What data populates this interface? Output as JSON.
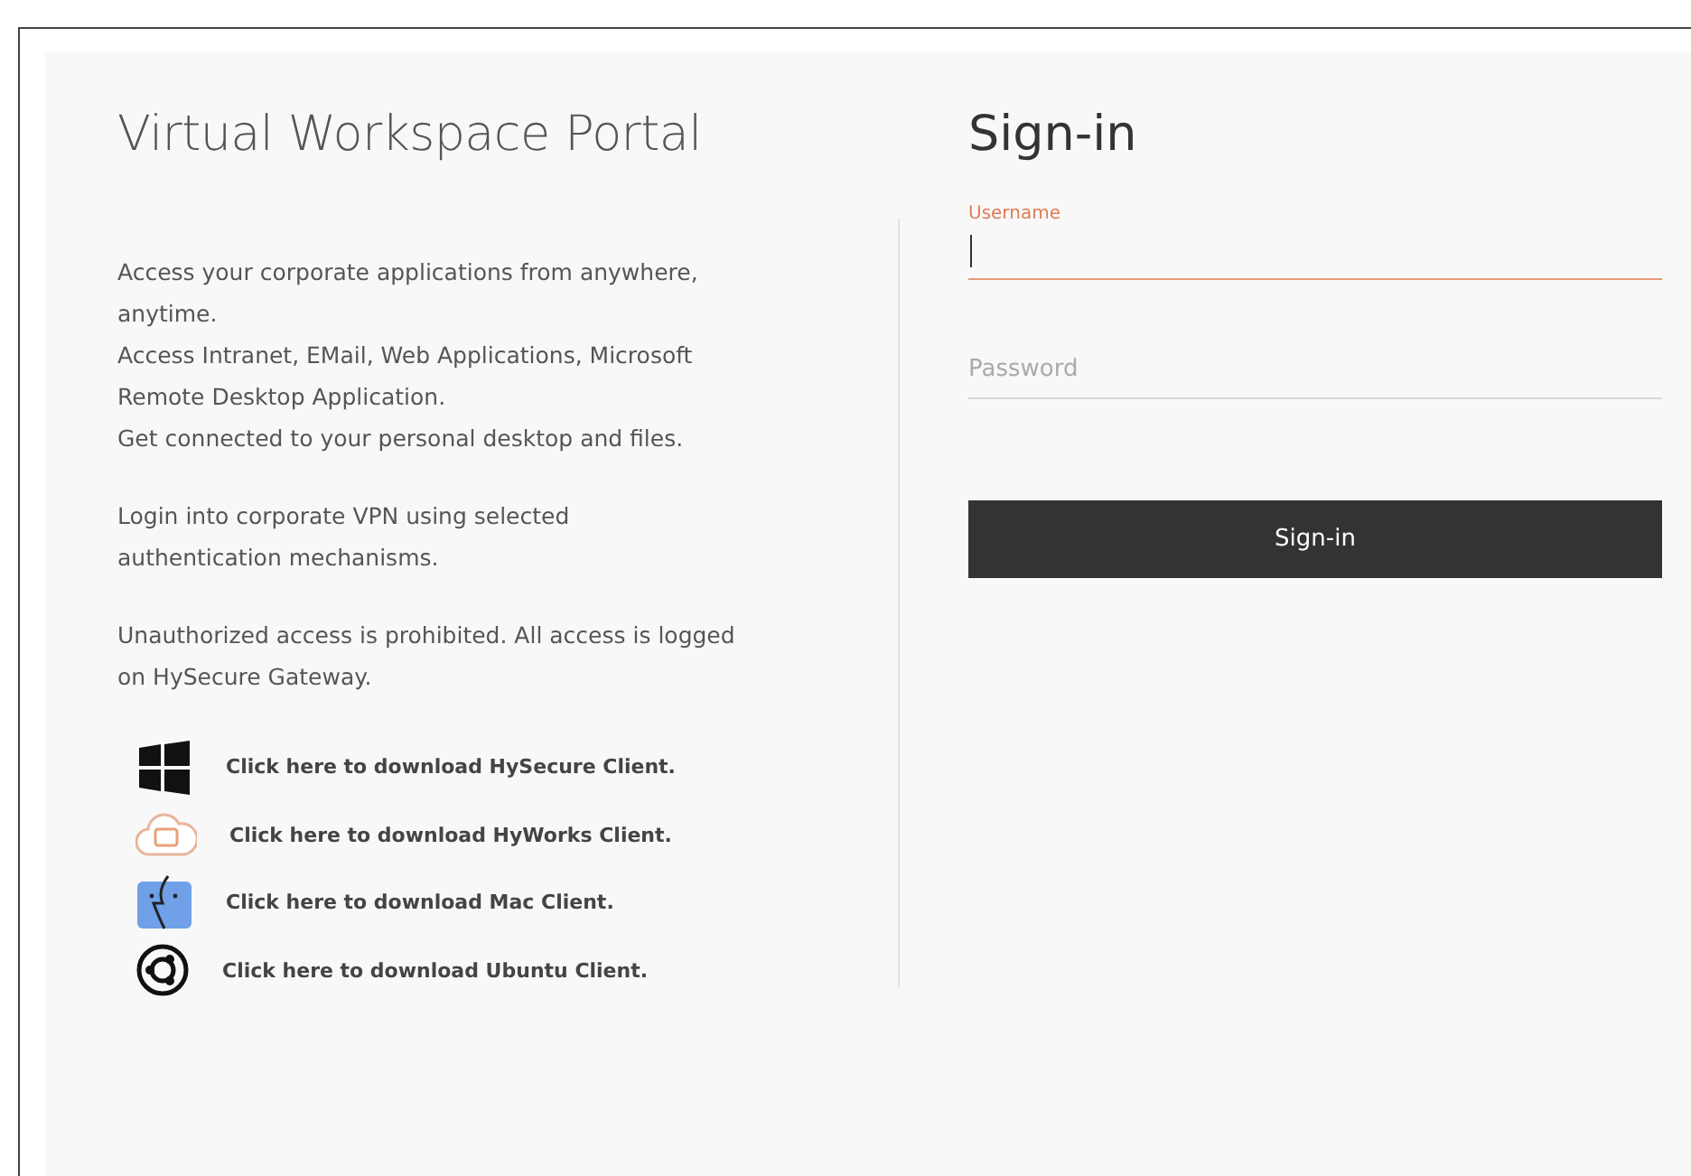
{
  "portal": {
    "title": "Virtual Workspace Portal",
    "paragraphs": [
      {
        "lines": [
          "Access your corporate applications from anywhere,",
          "anytime.",
          "Access Intranet, EMail, Web Applications, Microsoft",
          "Remote Desktop Application.",
          "Get connected to your personal desktop and files."
        ]
      },
      {
        "lines": [
          "Login into corporate VPN using selected",
          "authentication mechanisms."
        ]
      },
      {
        "lines": [
          "Unauthorized access is prohibited. All access is logged",
          "on HySecure Gateway."
        ]
      }
    ],
    "downloads": [
      {
        "kind": "windows",
        "label": "Click here to download HySecure Client."
      },
      {
        "kind": "cloud",
        "label": "Click here to download HyWorks Client."
      },
      {
        "kind": "mac",
        "label": "Click here to download Mac Client."
      },
      {
        "kind": "ubuntu",
        "label": "Click here to download Ubuntu Client."
      }
    ]
  },
  "signin": {
    "title": "Sign-in",
    "fields": [
      {
        "label": "Username",
        "focused": true
      },
      {
        "placeholder": "Password",
        "focused": false
      }
    ],
    "button": "Sign-in"
  }
}
